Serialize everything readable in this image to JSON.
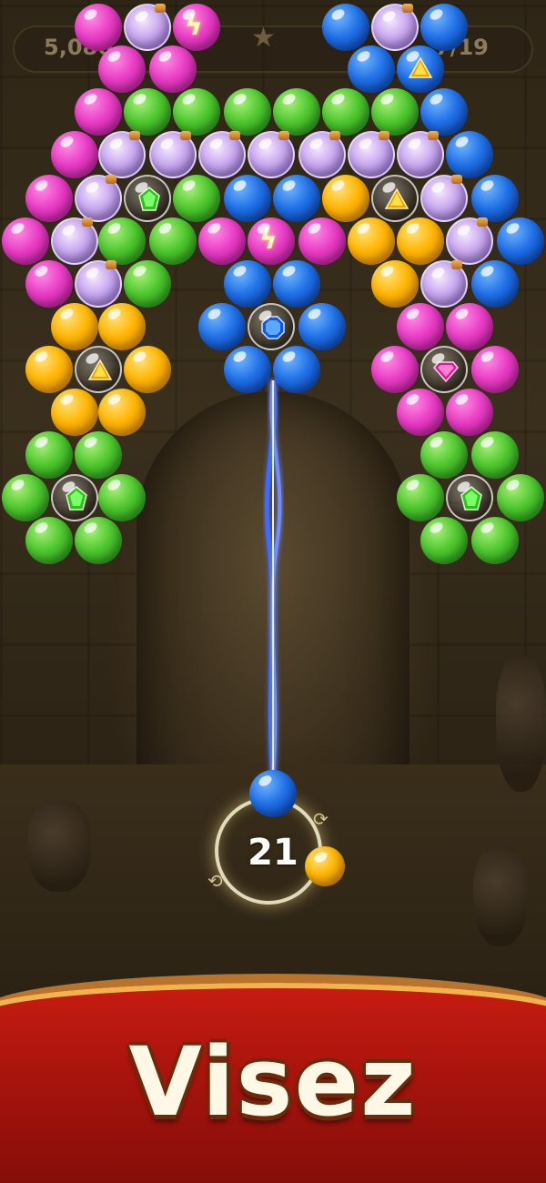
{
  "hud": {
    "score": "5,080",
    "moves": "7/19"
  },
  "launcher": {
    "shots_left": "21",
    "current_bubble_color": "blue",
    "next_bubble_color": "yellow"
  },
  "banner": {
    "text": "Visez"
  },
  "colors": {
    "banner_red": "#c81c12",
    "laser": "#3f6bff"
  }
}
